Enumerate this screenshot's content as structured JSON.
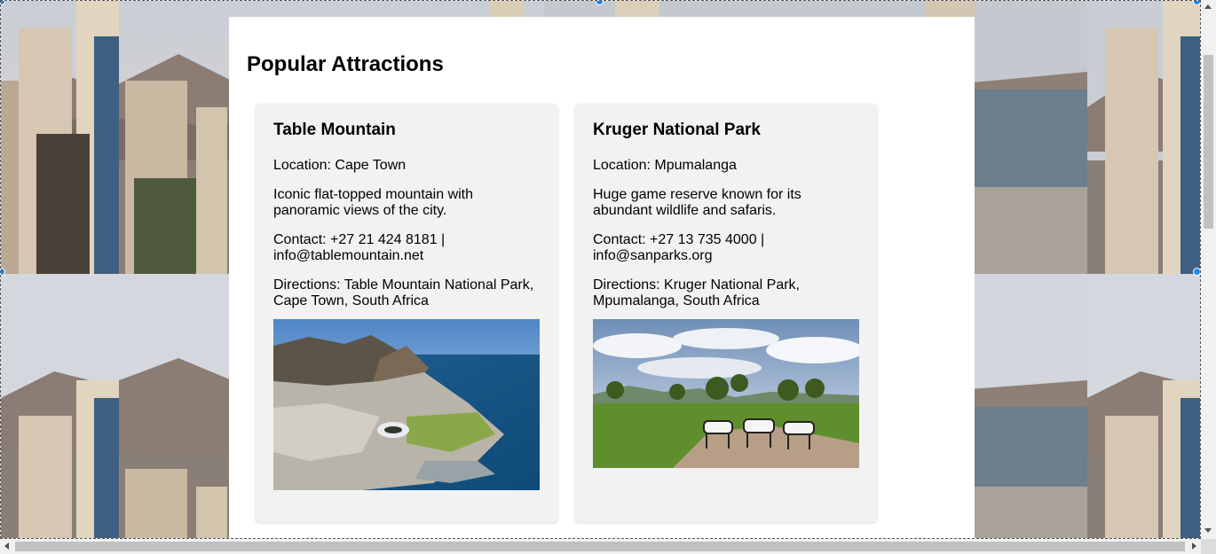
{
  "section": {
    "title": "Popular Attractions"
  },
  "attractions": [
    {
      "name": "Table Mountain",
      "location": "Location: Cape Town",
      "description": "Iconic flat-topped mountain with panoramic views of the city.",
      "contact": "Contact: +27 21 424 8181 | info@tablemountain.net",
      "directions": "Directions: Table Mountain National Park, Cape Town, South Africa",
      "image": "aerial-cape-town-photo"
    },
    {
      "name": "Kruger National Park",
      "location": "Location: Mpumalanga",
      "description": "Huge game reserve known for its abundant wildlife and safaris.",
      "contact": "Contact: +27 13 735 4000 | info@sanparks.org",
      "directions": "Directions: Kruger National Park, Mpumalanga, South Africa",
      "image": "zebras-savanna-photo"
    }
  ],
  "background": {
    "image": "city-beach-photo-tile"
  },
  "colors": {
    "panel": "#ffffff",
    "card": "#f2f2f2",
    "selection_handle": "#1e88e5",
    "scrollbar_thumb": "#c1c1c1"
  }
}
